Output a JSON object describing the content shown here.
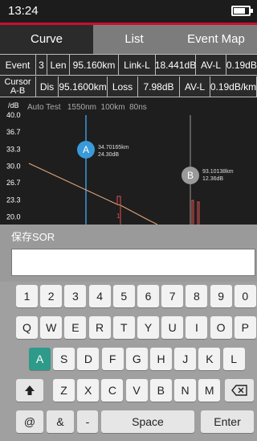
{
  "status": {
    "time": "13:24",
    "battery_level": 0.75
  },
  "tabs": [
    {
      "label": "Curve",
      "selected": true
    },
    {
      "label": "List",
      "selected": false
    },
    {
      "label": "Event Map",
      "selected": false
    }
  ],
  "info": {
    "event_label": "Event",
    "event_no": "3",
    "len_label": "Len",
    "len_value": "95.160km",
    "linkl_label": "Link-L",
    "linkl_value": "18.441dB",
    "avl_label": "AV-L",
    "avl_value": "0.19dB/km",
    "cursor_label_1": "Cursor",
    "cursor_label_2": "A-B",
    "dis_label": "Dis",
    "dis_value": "95.1600km",
    "loss_label": "Loss",
    "loss_value": "7.98dB",
    "avl2_label": "AV-L",
    "avl2_value": "0.19dB/km"
  },
  "chart_data": {
    "type": "line",
    "ylabel": "/dB",
    "header": "Auto Test   1550nm  100km  80ns",
    "y_ticks": [
      "40.0",
      "36.7",
      "33.3",
      "30.0",
      "26.7",
      "23.3",
      "20.0"
    ],
    "ylim": [
      18.5,
      40.0
    ],
    "cursor_a": {
      "label": "A",
      "text_1": "34.70165km",
      "text_2": "24.30dB"
    },
    "cursor_b": {
      "label": "B",
      "text_1": "93.10138km",
      "text_2": "12.36dB"
    },
    "event_marker": "1",
    "colors": {
      "trace": "#e8a87c",
      "cursor_a": "#3a9ad9",
      "cursor_b": "#9a9a9a",
      "event": "#e05050"
    }
  },
  "dialog": {
    "title": "保存SOR",
    "input_value": ""
  },
  "keyboard": {
    "row1": [
      "1",
      "2",
      "3",
      "4",
      "5",
      "6",
      "7",
      "8",
      "9",
      "0"
    ],
    "row2": [
      "Q",
      "W",
      "E",
      "R",
      "T",
      "Y",
      "U",
      "I",
      "O",
      "P"
    ],
    "row3": [
      "A",
      "S",
      "D",
      "F",
      "G",
      "H",
      "J",
      "K",
      "L"
    ],
    "row4": [
      "Z",
      "X",
      "C",
      "V",
      "B",
      "N",
      "M"
    ],
    "row5": [
      "@",
      "&",
      "-",
      "Space",
      "Enter"
    ],
    "active_key": "A"
  }
}
